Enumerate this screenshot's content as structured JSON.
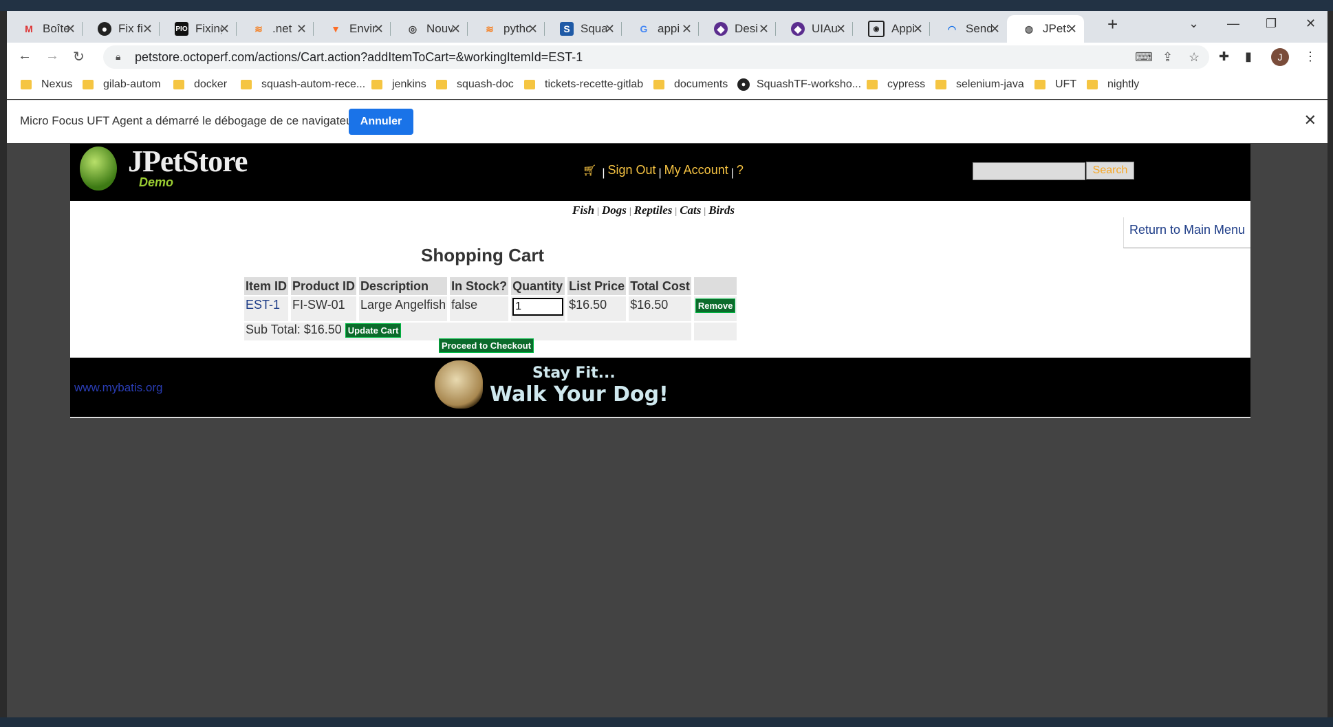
{
  "browser": {
    "tabs": [
      {
        "label": "Boîte",
        "icon": "gmail-icon"
      },
      {
        "label": "Fix fi",
        "icon": "github-icon"
      },
      {
        "label": "Fixing",
        "icon": "pio-icon"
      },
      {
        "label": ".net",
        "icon": "stackoverflow-icon"
      },
      {
        "label": "Envir",
        "icon": "gitlab-icon"
      },
      {
        "label": "Nouv",
        "icon": "chrome-icon"
      },
      {
        "label": "pytho",
        "icon": "stackoverflow-icon"
      },
      {
        "label": "Squa",
        "icon": "squash-icon"
      },
      {
        "label": "appi",
        "icon": "google-icon"
      },
      {
        "label": "Desi",
        "icon": "uiautomation-icon"
      },
      {
        "label": "UIAu",
        "icon": "uiautomation-icon"
      },
      {
        "label": "Appi",
        "icon": "appium-icon"
      },
      {
        "label": "Send",
        "icon": "loading-icon"
      },
      {
        "label": "JPetS",
        "icon": "globe-icon",
        "active": true
      }
    ],
    "url": "petstore.octoperf.com/actions/Cart.action?addItemToCart=&workingItemId=EST-1",
    "avatar_letter": "J",
    "bookmarks": [
      "Nexus",
      "gilab-autom",
      "docker",
      "squash-autom-rece...",
      "jenkins",
      "squash-doc",
      "tickets-recette-gitlab",
      "documents",
      "SquashTF-worksho...",
      "cypress",
      "selenium-java",
      "UFT",
      "nightly"
    ]
  },
  "infobar": {
    "message": "Micro Focus UFT Agent a démarré le débogage de ce navigateur",
    "button": "Annuler"
  },
  "header": {
    "logo": "JPetStore",
    "logo_sub": "Demo",
    "sign_out": "Sign Out",
    "my_account": "My Account",
    "help": "?",
    "search_button": "Search",
    "search_value": ""
  },
  "categories": [
    "Fish",
    "Dogs",
    "Reptiles",
    "Cats",
    "Birds"
  ],
  "return_link": "Return to Main Menu",
  "cart": {
    "title": "Shopping Cart",
    "columns": [
      "Item ID",
      "Product ID",
      "Description",
      "In Stock?",
      "Quantity",
      "List Price",
      "Total Cost",
      ""
    ],
    "rows": [
      {
        "item_id": "EST-1",
        "product_id": "FI-SW-01",
        "description": "Large Angelfish",
        "in_stock": "false",
        "quantity": "1",
        "list_price": "$16.50",
        "total_cost": "$16.50",
        "remove": "Remove"
      }
    ],
    "subtotal": "Sub Total: $16.50",
    "update_button": "Update Cart",
    "checkout_button": "Proceed to Checkout"
  },
  "footer": {
    "link": "www.mybatis.org",
    "slogan_line1": "Stay Fit...",
    "slogan_line2": "Walk Your Dog!"
  },
  "colors": {
    "accent_orange": "#f6c342",
    "checkout_green": "#0b6b2b",
    "link_blue": "#1d3c87",
    "chrome_blue": "#1a73e8"
  }
}
